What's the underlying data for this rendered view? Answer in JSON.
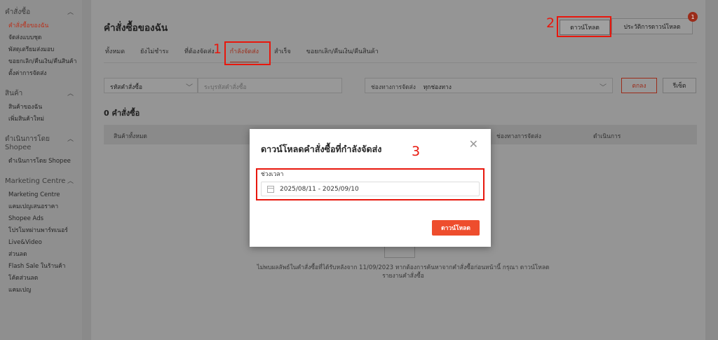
{
  "sidebar": {
    "sections": [
      {
        "title": "คำสั่งซื้อ",
        "items": [
          "คำสั่งซื้อของฉัน",
          "จัดส่งแบบชุด",
          "พัสดุเตรียมส่งมอบ",
          "ขอยกเลิก/คืนเงิน/คืนสินค้า",
          "ตั้งค่าการจัดส่ง"
        ]
      },
      {
        "title": "สินค้า",
        "items": [
          "สินค้าของฉัน",
          "เพิ่มสินค้าใหม่"
        ]
      },
      {
        "title": "ดำเนินการโดย Shopee",
        "items": [
          "ดำเนินการโดย Shopee"
        ]
      },
      {
        "title": "Marketing Centre",
        "items": [
          "Marketing Centre",
          "แคมเปญเสนอราคา",
          "Shopee Ads",
          "โปรโมทผ่านพาร์ทเนอร์",
          "Live&Video",
          "ส่วนลด",
          "Flash Sale ในร้านค้า",
          "โค้ดส่วนลด",
          "แคมเปญ"
        ]
      }
    ]
  },
  "header": {
    "title": "คำสั่งซื้อของฉัน",
    "download_label": "ดาวน์โหลด",
    "history_label": "ประวัติการดาวน์โหลด",
    "badge_count": "1"
  },
  "tabs": [
    "ทั้งหมด",
    "ยังไม่ชำระ",
    "ที่ต้องจัดส่ง",
    "กำลังจัดส่ง",
    "สำเร็จ",
    "ขอยกเลิก/คืนเงิน/คืนสินค้า"
  ],
  "filters": {
    "order_select": "รหัสคำสั่งซื้อ",
    "order_placeholder": "ระบุรหัสคำสั่งซื้อ",
    "shipping_label": "ช่องทางการจัดส่ง",
    "shipping_value": "ทุกช่องทาง",
    "ok_label": "ตกลง",
    "reset_label": "รีเซ็ต"
  },
  "results": {
    "count_label": "0 คำสั่งซื้อ",
    "col_products": "สินค้าทั้งหมด",
    "col_shipping": "ช่องทางการจัดส่ง",
    "col_action": "ดำเนินการ",
    "empty_text": "ไม่พบผลลัพธ์ในคำสั่งซื้อที่ได้รับหลังจาก 11/09/2023 หากต้องการค้นหาจากคำสั่งซื้อก่อนหน้านี้ กรุณา ดาวน์โหลดรายงานคำสั่งซื้อ"
  },
  "modal": {
    "title": "ดาวน์โหลดคำสั่งซื้อที่กำลังจัดส่ง",
    "field_label": "ช่วงเวลา",
    "date_range": "2025/08/11 - 2025/09/10",
    "button_label": "ดาวน์โหลด"
  },
  "annotations": [
    "1",
    "2",
    "3"
  ],
  "colors": {
    "accent": "#ee4d2d",
    "annotation": "#e8170d"
  }
}
